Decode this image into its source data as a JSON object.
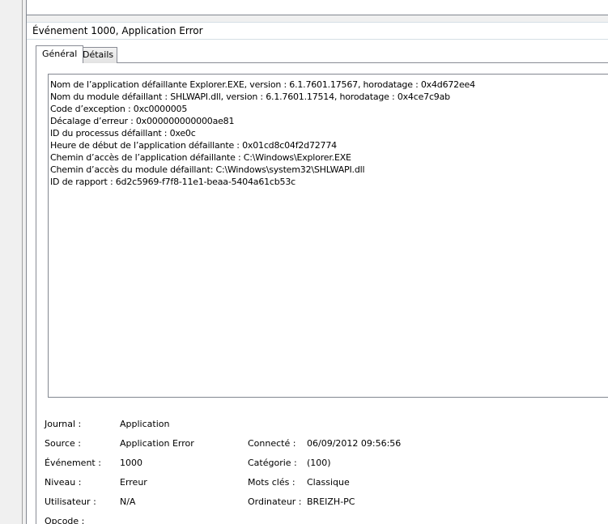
{
  "event": {
    "header_title": "Événement 1000, Application Error"
  },
  "tabs": [
    {
      "label": "Général",
      "active": true
    },
    {
      "label": "Détails",
      "active": false
    }
  ],
  "description_lines": [
    "Nom de l’application défaillante Explorer.EXE, version : 6.1.7601.17567, horodatage : 0x4d672ee4",
    "Nom du module défaillant : SHLWAPI.dll, version : 6.1.7601.17514, horodatage : 0x4ce7c9ab",
    "Code d’exception : 0xc0000005",
    "Décalage d’erreur : 0x000000000000ae81",
    "ID du processus défaillant : 0xe0c",
    "Heure de début de l’application défaillante : 0x01cd8c04f2d72774",
    "Chemin d’accès de l’application défaillante : C:\\Windows\\Explorer.EXE",
    "Chemin d’accès du module défaillant: C:\\Windows\\system32\\SHLWAPI.dll",
    "ID de rapport : 6d2c5969-f7f8-11e1-beaa-5404a61cb53c"
  ],
  "properties": {
    "journal": {
      "label": "Journal :",
      "value": "Application"
    },
    "source": {
      "label": "Source :",
      "value": "Application Error"
    },
    "evenement": {
      "label": "Événement :",
      "value": "1000"
    },
    "niveau": {
      "label": "Niveau :",
      "value": "Erreur"
    },
    "utilisateur": {
      "label": "Utilisateur :",
      "value": "N/A"
    },
    "opcode": {
      "label": "Opcode :",
      "value": ""
    },
    "connecte": {
      "label": "Connecté :",
      "value": "06/09/2012 09:56:56"
    },
    "categorie": {
      "label": "Catégorie :",
      "value": "(100)"
    },
    "mots_cles": {
      "label": "Mots clés :",
      "value": "Classique"
    },
    "ordinateur": {
      "label": "Ordinateur :",
      "value": "BREIZH-PC"
    }
  },
  "colors": {
    "background": "#ffffff",
    "chrome": "#f0f0f0",
    "border": "#828790",
    "tab_border": "#898c95"
  }
}
